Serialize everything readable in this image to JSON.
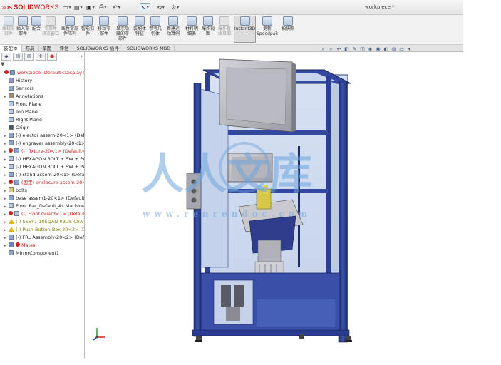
{
  "app": {
    "brand_prefix": "3DS",
    "brand_solid": "SOLID",
    "brand_works": "WORKS",
    "document_title": "workpiece *"
  },
  "quick_access": [
    "new",
    "open",
    "save",
    "print",
    "undo",
    "select",
    "rebuild",
    "options"
  ],
  "commands": [
    {
      "label": "插入零\n部件",
      "state": "normal"
    },
    {
      "label": "配合",
      "state": "normal"
    },
    {
      "label": "零部件\n预览窗口",
      "state": "dim"
    },
    {
      "label": "线性零部\n件阵列",
      "state": "normal"
    },
    {
      "label": "智能扣\n件",
      "state": "normal"
    },
    {
      "label": "移动零\n部件",
      "state": "normal"
    },
    {
      "label": "显示隐\n藏的零\n部件",
      "state": "normal"
    },
    {
      "label": "装配体\n特征",
      "state": "normal"
    },
    {
      "label": "参考几\n何体",
      "state": "normal"
    },
    {
      "label": "新建运\n动算例",
      "state": "normal"
    },
    {
      "label": "材料明\n细表",
      "state": "normal"
    },
    {
      "label": "爆炸视\n图",
      "state": "normal"
    },
    {
      "label": "爆炸直\n线草图",
      "state": "dim"
    },
    {
      "label": "Instant3D",
      "state": "active"
    },
    {
      "label": "更新\nSpeedpak",
      "state": "normal"
    },
    {
      "label": "拍快照",
      "state": "normal"
    }
  ],
  "tabs": [
    "装配体",
    "布局",
    "草图",
    "评估",
    "SOLIDWORKS 插件",
    "SOLIDWORKS MBD"
  ],
  "hud_icons": [
    "zoom-fit",
    "zoom-area",
    "previous-view",
    "section-view",
    "dynamic-annotation",
    "view-orientation",
    "display-style",
    "hide-show",
    "edit-appearance",
    "apply-scene",
    "view-settings",
    "display"
  ],
  "panel": {
    "tab_icons": [
      "feature-manager",
      "property-manager",
      "configuration-manager",
      "dimxpert",
      "display-manager"
    ],
    "filter_symbol": "▼",
    "tree": [
      {
        "text": "workpiece  (Default<Display State",
        "style": "red",
        "icon": "assembly"
      },
      {
        "text": "History",
        "style": "normal",
        "icon": "history"
      },
      {
        "text": "Sensors",
        "style": "normal",
        "icon": "sensor"
      },
      {
        "text": "Annotations",
        "style": "normal",
        "icon": "annotation"
      },
      {
        "text": "Front Plane",
        "style": "normal",
        "icon": "plane"
      },
      {
        "text": "Top Plane",
        "style": "normal",
        "icon": "plane"
      },
      {
        "text": "Right Plane",
        "style": "normal",
        "icon": "plane"
      },
      {
        "text": "Origin",
        "style": "normal",
        "icon": "origin"
      },
      {
        "text": "(-) ejector assem-20<1> (Default<",
        "style": "normal",
        "icon": "subassembly"
      },
      {
        "text": "(-) engraver assembly-20<1> (De",
        "style": "normal",
        "icon": "subassembly"
      },
      {
        "text": "(-) fixture-20<1> (Default<Dis",
        "style": "red",
        "icon": "subassembly"
      },
      {
        "text": "(-) HEXAGON BOLT + SW + PW [",
        "style": "normal",
        "icon": "part"
      },
      {
        "text": "(-) HEXAGON BOLT + SW + PW [",
        "style": "normal",
        "icon": "part"
      },
      {
        "text": "(-) stand assem-20<1> (Default<",
        "style": "normal",
        "icon": "subassembly"
      },
      {
        "text": "(固定) enclosure assem-20<1>",
        "style": "red",
        "icon": "subassembly"
      },
      {
        "text": "bolts",
        "style": "normal",
        "icon": "folder"
      },
      {
        "text": "base assem1-20<1> (Default<Dis",
        "style": "normal",
        "icon": "subassembly"
      },
      {
        "text": "Front Bar_Default_As Machined_-2",
        "style": "normal",
        "icon": "part"
      },
      {
        "text": "(-) Front Guard<1> (Default<",
        "style": "red",
        "icon": "part"
      },
      {
        "text": "(-) SS5Y7-10SQAN-03DS-C8A",
        "style": "olive",
        "icon": "warning"
      },
      {
        "text": "(-) Push Button Box-20<2> (D",
        "style": "olive",
        "icon": "warning"
      },
      {
        "text": "(-) FRL Assembly-20<2> (Default<",
        "style": "normal",
        "icon": "subassembly"
      },
      {
        "text": "Mates",
        "style": "red",
        "icon": "mates"
      },
      {
        "text": "MirrorComponent1",
        "style": "normal",
        "icon": "mirror"
      }
    ]
  },
  "watermark": {
    "chars": "人人文库",
    "url": "www.renrendoc.com"
  },
  "colors": {
    "accent_red": "#d0121b",
    "frame_blue": "#2b3f8f",
    "glass": "#c8d6ee",
    "enclosure": "#b8b8bf"
  }
}
